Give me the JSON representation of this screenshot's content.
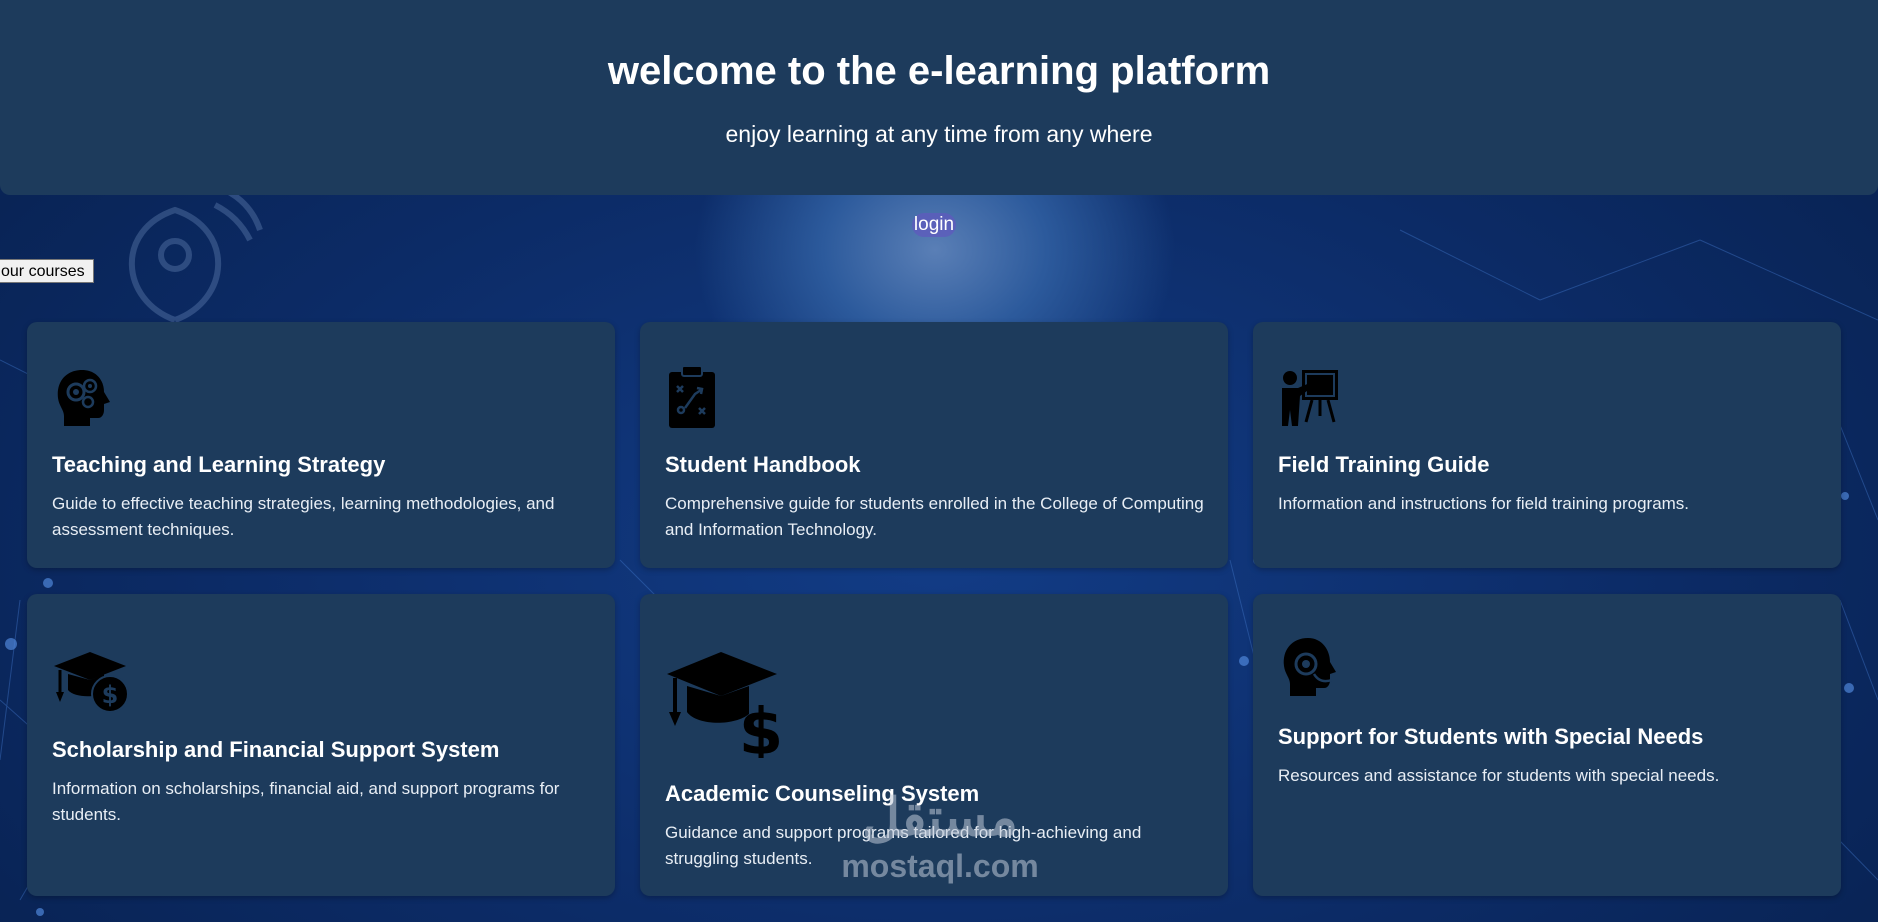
{
  "header": {
    "title": "welcome to the e-learning platform",
    "subtitle": "enjoy learning at any time from any where"
  },
  "login_label": "login",
  "courses_button_label": "our courses",
  "cards": [
    {
      "icon": "head-gears-icon",
      "title": "Teaching and Learning Strategy",
      "description": "Guide to effective teaching strategies, learning methodologies, and assessment techniques."
    },
    {
      "icon": "strategy-clipboard-icon",
      "title": "Student Handbook",
      "description": "Comprehensive guide for students enrolled in the College of Computing and Information Technology."
    },
    {
      "icon": "teacher-board-icon",
      "title": "Field Training Guide",
      "description": "Information and instructions for field training programs."
    },
    {
      "icon": "graduation-cap-dollar-icon",
      "title": "Scholarship and Financial Support System",
      "description": "Information on scholarships, financial aid, and support programs for students."
    },
    {
      "icon": "graduation-cap-dollar-icon",
      "title": "Academic Counseling System",
      "description": "Guidance and support programs tailored for high-achieving and struggling students."
    },
    {
      "icon": "head-headset-icon",
      "title": "Support for Students with Special Needs",
      "description": "Resources and assistance for students with special needs."
    }
  ],
  "watermark": {
    "arabic": "مستقل",
    "latin": "mostaql.com"
  }
}
